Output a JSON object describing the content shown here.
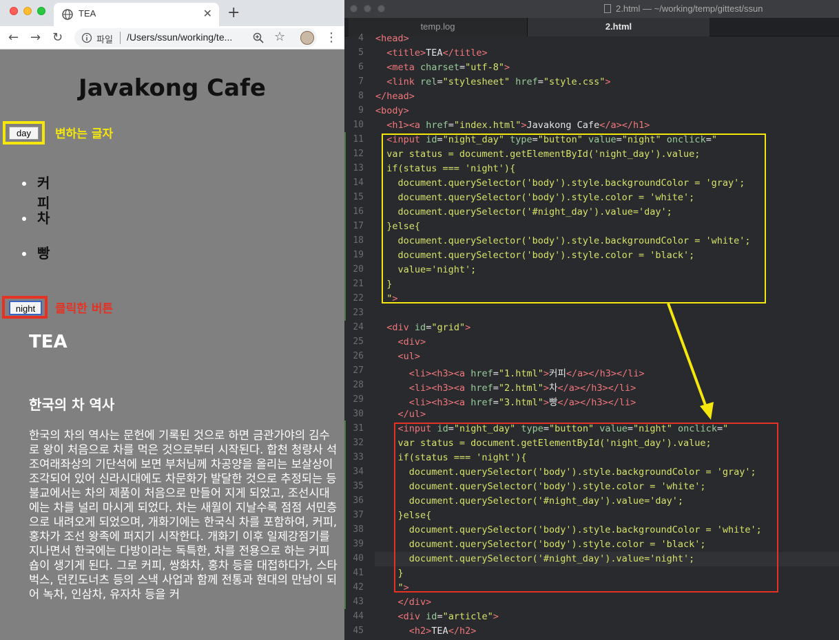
{
  "browser": {
    "tab_title": "TEA",
    "tab_close": "✕",
    "new_tab": "+",
    "scheme_label": "파일",
    "url": "/Users/ssun/working/te...",
    "nav": {
      "back": "←",
      "forward": "→",
      "reload": "↻"
    },
    "star": "☆",
    "menu": "⋮"
  },
  "page": {
    "heading": "Javakong Cafe",
    "day_button": "day",
    "day_note": "변하는 글자",
    "menu_items": [
      "커피",
      "차",
      "빵"
    ],
    "night_button": "night",
    "night_note": "클릭한 버튼",
    "article_title": "TEA",
    "section_title": "한국의 차 역사",
    "paragraph": "한국의 차의 역사는 문헌에 기록된 것으로 하면 금관가야의 김수로 왕이 처음으로 차를 먹은 것으로부터 시작된다. 합천 청량사 석조여래좌상의 기단석에 보면 부처님께 차공양을 올리는 보살상이 조각되어 있어 신라시대에도 차문화가 발달한 것으로 추정되는 등 불교에서는 차의 제품이 처음으로 만들어 지게 되었고, 조선시대에는 차를 널리 마시게 되었다. 차는 새월이 지날수록 점점 서민층으로 내려오게 되었으며, 개화기에는 한국식 차를 포함하여, 커피, 홍차가 조선 왕족에 퍼지기 시작한다. 개화기 이후 일제강점기를 지나면서 한국에는 다방이라는 독특한, 차를 전용으로 하는 커피숍이 생기게 된다. 그로 커피, 쌍화차, 홍차 등을 대접하다가, 스타벅스, 던킨도너츠 등의 스낵 사업과 함께 전통과 현대의 만남이 되어 녹차, 인삼차, 유자차 등을 커"
  },
  "editor": {
    "window_title": "2.html — ~/working/temp/gittest/ssun",
    "tabs": [
      "temp.log",
      "2.html"
    ],
    "line_numbers": [
      "4",
      "5",
      "6",
      "7",
      "8",
      "9",
      "10",
      "11",
      "12",
      "13",
      "14",
      "15",
      "16",
      "17",
      "18",
      "19",
      "20",
      "21",
      "22",
      "23",
      "24",
      "25",
      "26",
      "27",
      "28",
      "29",
      "30",
      "31",
      "32",
      "33",
      "34",
      "35",
      "36",
      "37",
      "38",
      "39",
      "40",
      "41",
      "42",
      "43",
      "44",
      "45"
    ]
  },
  "colors": {
    "page_bg": "#808080",
    "yellow_highlight": "#f5e60c",
    "red_highlight": "#e53224",
    "editor_bg": "#282a2e"
  }
}
